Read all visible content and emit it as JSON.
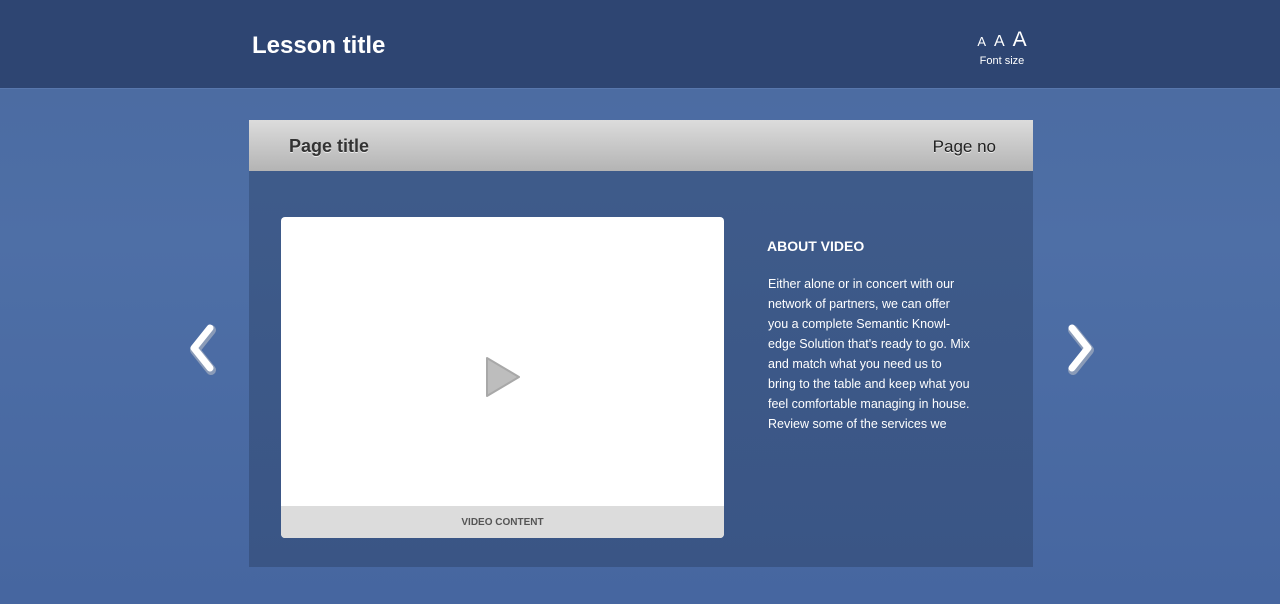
{
  "header": {
    "lesson_title": "Lesson title",
    "font_size": {
      "small": "A",
      "medium": "A",
      "large": "A",
      "label": "Font size"
    }
  },
  "page": {
    "title": "Page title",
    "page_no": "Page no"
  },
  "video": {
    "play_icon": "play-icon",
    "footer_label": "VIDEO CONTENT"
  },
  "about": {
    "title": "ABOUT VIDEO",
    "lines": [
      "Either alone or in concert with our",
      "network of partners, we can offer",
      "you a complete Semantic Knowl-",
      "edge Solution that's ready to go. Mix",
      "and match what you need us to",
      "bring to the table and keep what you",
      "feel comfortable managing in house.",
      "Review some of the services we"
    ]
  },
  "navigation": {
    "prev_icon": "chevron-left-icon",
    "next_icon": "chevron-right-icon"
  },
  "colors": {
    "topbar": "#2e4572",
    "background": "#4a6aa0",
    "panel": "#3f5c8b",
    "panel_header": "#c4c4c4"
  }
}
